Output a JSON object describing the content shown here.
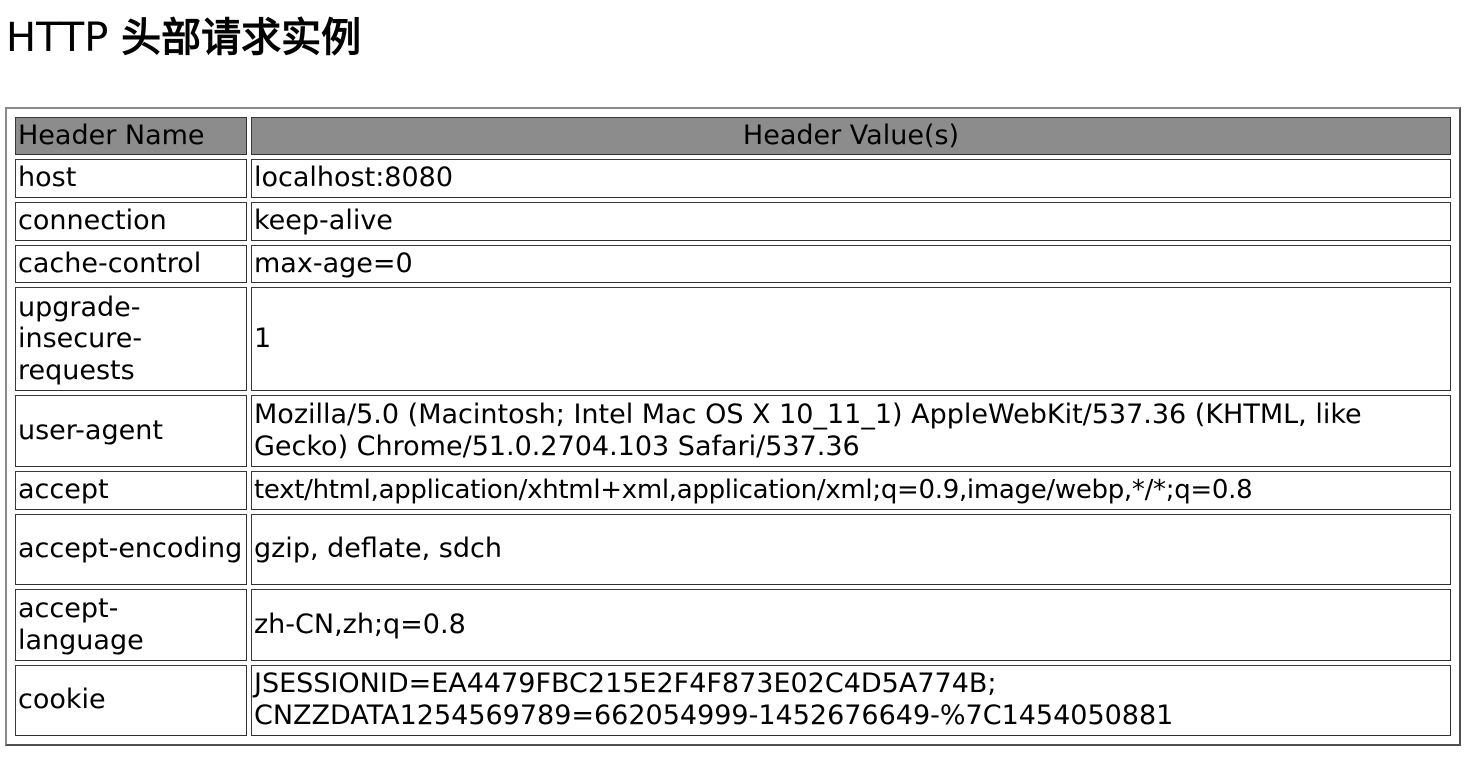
{
  "page": {
    "title_prefix": "HTTP ",
    "title_main": "头部请求实例"
  },
  "table": {
    "headers": {
      "name": "Header Name",
      "value": "Header Value(s)"
    },
    "rows": [
      {
        "name": "host",
        "value": "localhost:8080"
      },
      {
        "name": "connection",
        "value": "keep-alive"
      },
      {
        "name": "cache-control",
        "value": "max-age=0"
      },
      {
        "name": "upgrade-insecure-requests",
        "value": "1"
      },
      {
        "name": "user-agent",
        "value": "Mozilla/5.0 (Macintosh; Intel Mac OS X 10_11_1) AppleWebKit/537.36 (KHTML, like Gecko) Chrome/51.0.2704.103 Safari/537.36"
      },
      {
        "name": "accept",
        "value": "text/html,application/xhtml+xml,application/xml;q=0.9,image/webp,*/*;q=0.8"
      },
      {
        "name": "accept-encoding",
        "value": "gzip, deflate, sdch"
      },
      {
        "name": "accept-language",
        "value": "zh-CN,zh;q=0.8"
      },
      {
        "name": "cookie",
        "value": "JSESSIONID=EA4479FBC215E2F4F873E02C4D5A774B; CNZZDATA1254569789=662054999-1452676649-%7C1454050881"
      }
    ]
  },
  "colors": {
    "header_bg": "#8c8c8c",
    "border": "#303030",
    "frame_border": "#8a8a8a"
  }
}
